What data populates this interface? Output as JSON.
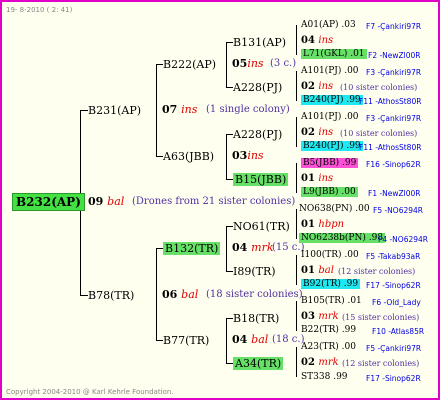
{
  "header": "19-  8-2010 ( 2: 41)",
  "footer": "Copyright 2004-2010 @ Karl Kehrle Foundation.",
  "root": {
    "label": "B232(AP)",
    "year": "09",
    "ins": "bal",
    "note": "(Drones from 21 sister colonies)"
  },
  "upper": {
    "label": "B231(AP)",
    "year": "07",
    "ins": "ins",
    "note": "(1 single colony)"
  },
  "lower": {
    "label": "B78(TR)",
    "year": "06",
    "ins": "bal",
    "note": "(18 sister colonies)"
  },
  "uu": {
    "label": "B222(AP)",
    "year": "05",
    "ins": "ins",
    "note": "(3 c.)"
  },
  "ul": {
    "label": "A63(JBB)",
    "year": "03",
    "ins": "ins"
  },
  "lu": {
    "label": "B132(TR)",
    "year": "04",
    "ins": "mrk",
    "note": "(15 c.)"
  },
  "ll": {
    "label": "B77(TR)",
    "year": "04",
    "ins": "bal",
    "note": "(18 c.)"
  },
  "g3": [
    {
      "label": "B131(AP)"
    },
    {
      "label": "A228(PJ)"
    },
    {
      "label": "A228(PJ)"
    },
    {
      "label": "B15(JBB)"
    },
    {
      "label": "NO61(TR)"
    },
    {
      "label": "I89(TR)"
    },
    {
      "label": "B18(TR)"
    },
    {
      "label": "A34(TR)"
    }
  ],
  "g4": [
    {
      "top": "A01(AP) .03",
      "topcode": "F7 -Çankiri97R",
      "year": "04",
      "ins": "ins",
      "note": "",
      "bot": "L71(GKL) .01",
      "botcode": "F2 -NewZl00R"
    },
    {
      "top": "A101(PJ) .00",
      "topcode": "F3 -Çankiri97R",
      "year": "02",
      "ins": "ins",
      "note": "(10 sister colonies)",
      "bot": "B240(PJ) .99",
      "botcode": "F11 -AthosSt80R"
    },
    {
      "top": "A101(PJ) .00",
      "topcode": "F3 -Çankiri97R",
      "year": "02",
      "ins": "ins",
      "note": "(10 sister colonies)",
      "bot": "B240(PJ) .99",
      "botcode": "F11 -AthosSt80R"
    },
    {
      "top": "B5(JBB) .99",
      "topcode": "F16 -Sinop62R",
      "year": "01",
      "ins": "ins",
      "note": "",
      "bot": "L9(JBB) .00",
      "botcode": "F1 -NewZl00R"
    },
    {
      "top": "NO638(PN) .00",
      "topcode": "F5 -NO6294R",
      "year": "01",
      "ins": "hbpn",
      "note": "",
      "bot": "NO6238b(PN) .98",
      "botcode": "F4 -NO6294R"
    },
    {
      "top": "I100(TR) .00",
      "topcode": "F5 -Takab93aR",
      "year": "01",
      "ins": "bal",
      "note": "(12 sister colonies)",
      "bot": "B92(TR) .99",
      "botcode": "F17 -Sinop62R"
    },
    {
      "top": "B105(TR) .01",
      "topcode": "F6 -Old_Lady",
      "year": "03",
      "ins": "mrk",
      "note": "(15 sister colonies)",
      "bot": "B22(TR) .99",
      "botcode": "F10 -Atlas85R"
    },
    {
      "top": "A23(TR) .00",
      "topcode": "F5 -Çankiri97R",
      "year": "02",
      "ins": "mrk",
      "note": "(12 sister colonies)",
      "bot": "ST338 .99",
      "botcode": "F17 -Sinop62R"
    }
  ]
}
